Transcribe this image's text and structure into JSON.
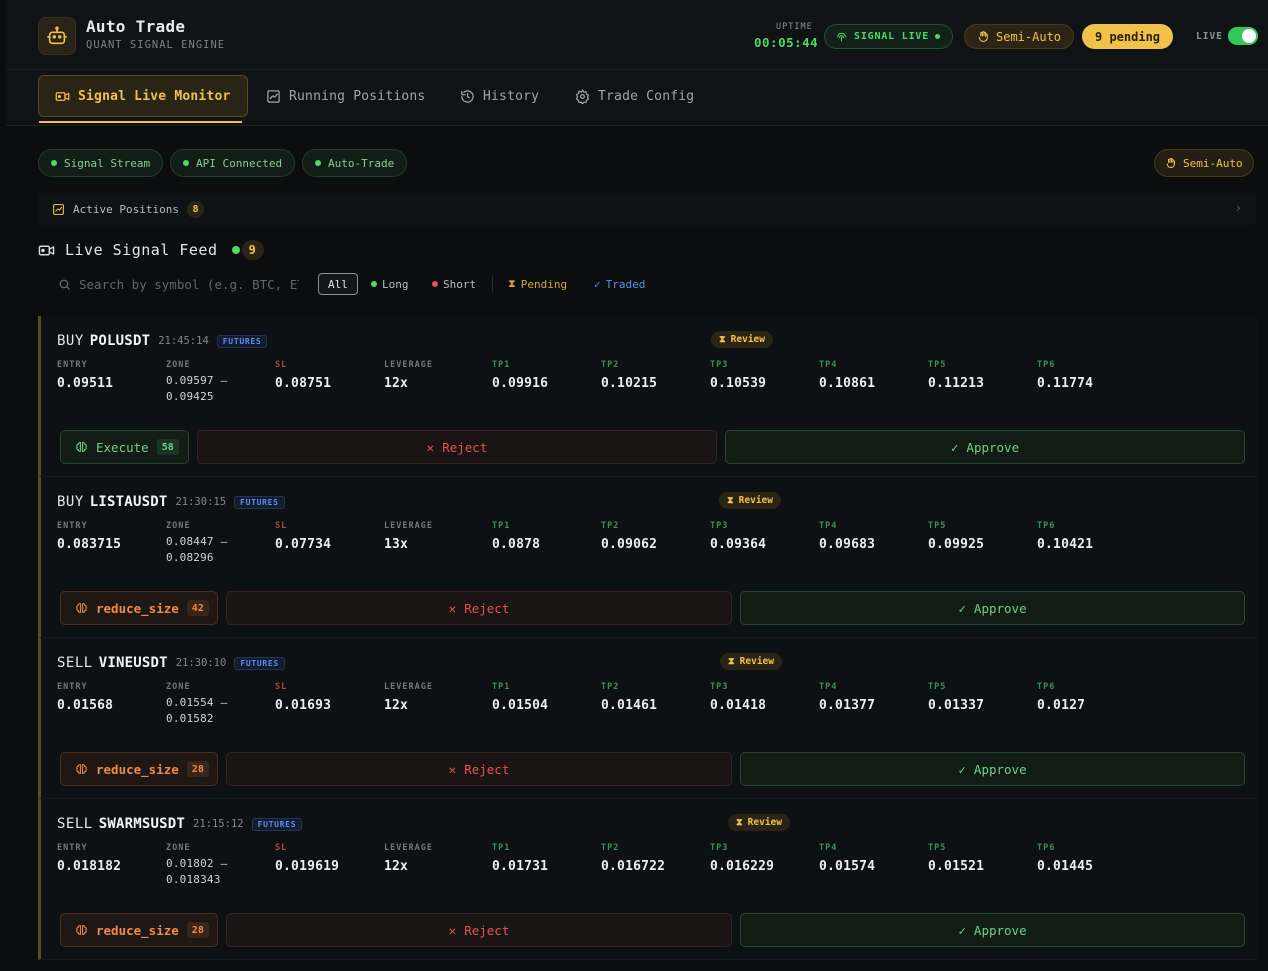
{
  "header": {
    "title": "Auto Trade",
    "subtitle": "QUANT SIGNAL ENGINE",
    "uptime_label": "UPTIME",
    "uptime_value": "00:05:44",
    "signal_status": "SIGNAL LIVE",
    "mode": "Semi-Auto",
    "pending": "9 pending",
    "live_label": "LIVE",
    "live_on": true
  },
  "tabs": [
    {
      "label": "Signal Live Monitor",
      "active": true
    },
    {
      "label": "Running Positions",
      "active": false
    },
    {
      "label": "History",
      "active": false
    },
    {
      "label": "Trade Config",
      "active": false
    }
  ],
  "status_chips": [
    "Signal Stream",
    "API Connected",
    "Auto-Trade"
  ],
  "mode_chip": "Semi-Auto",
  "active_positions": {
    "label": "Active Positions",
    "count": "8"
  },
  "feed": {
    "title": "Live Signal Feed",
    "count": "9",
    "search_placeholder": "Search by symbol (e.g. BTC, ETH)...",
    "filters": [
      "All",
      "Long",
      "Short",
      "Pending",
      "Traded"
    ]
  },
  "field_labels": {
    "entry": "ENTRY",
    "zone": "ZONE",
    "sl": "SL",
    "leverage": "LEVERAGE",
    "tp1": "TP1",
    "tp2": "TP2",
    "tp3": "TP3",
    "tp4": "TP4",
    "tp5": "TP5",
    "tp6": "TP6"
  },
  "buttons": {
    "reject": "Reject",
    "approve": "Approve"
  },
  "signals": [
    {
      "side": "BUY",
      "symbol": "POLUSDT",
      "time": "21:45:14",
      "market": "FUTURES",
      "status": "Review",
      "entry": "0.09511",
      "zone_high": "0.09597 –",
      "zone_low": "0.09425",
      "sl": "0.08751",
      "leverage": "12x",
      "tp1": "0.09916",
      "tp2": "0.10215",
      "tp3": "0.10539",
      "tp4": "0.10861",
      "tp5": "0.11213",
      "tp6": "0.11774",
      "action": "Execute",
      "action_score": "58"
    },
    {
      "side": "BUY",
      "symbol": "LISTAUSDT",
      "time": "21:30:15",
      "market": "FUTURES",
      "status": "Review",
      "entry": "0.083715",
      "zone_high": "0.08447 –",
      "zone_low": "0.08296",
      "sl": "0.07734",
      "leverage": "13x",
      "tp1": "0.0878",
      "tp2": "0.09062",
      "tp3": "0.09364",
      "tp4": "0.09683",
      "tp5": "0.09925",
      "tp6": "0.10421",
      "action": "reduce_size",
      "action_score": "42"
    },
    {
      "side": "SELL",
      "symbol": "VINEUSDT",
      "time": "21:30:10",
      "market": "FUTURES",
      "status": "Review",
      "entry": "0.01568",
      "zone_high": "0.01554 –",
      "zone_low": "0.01582",
      "sl": "0.01693",
      "leverage": "12x",
      "tp1": "0.01504",
      "tp2": "0.01461",
      "tp3": "0.01418",
      "tp4": "0.01377",
      "tp5": "0.01337",
      "tp6": "0.0127",
      "action": "reduce_size",
      "action_score": "28"
    },
    {
      "side": "SELL",
      "symbol": "SWARMSUSDT",
      "time": "21:15:12",
      "market": "FUTURES",
      "status": "Review",
      "entry": "0.018182",
      "zone_high": "0.01802 –",
      "zone_low": "0.018343",
      "sl": "0.019619",
      "leverage": "12x",
      "tp1": "0.01731",
      "tp2": "0.016722",
      "tp3": "0.016229",
      "tp4": "0.01574",
      "tp5": "0.01521",
      "tp6": "0.01445",
      "action": "reduce_size",
      "action_score": "28"
    }
  ]
}
